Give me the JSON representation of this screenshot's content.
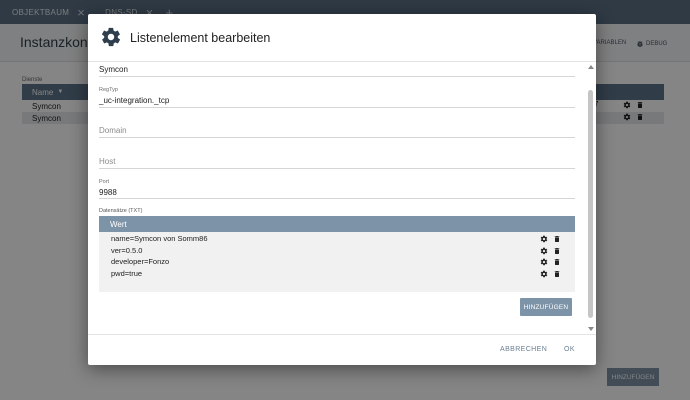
{
  "tabs": [
    {
      "label": "OBJEKTBAUM"
    },
    {
      "label": "DNS-SD"
    }
  ],
  "background": {
    "page_title": "Instanzkonfi",
    "toolbar_variables": "VARIABLEN",
    "toolbar_debug": "DEBUG",
    "list_label": "Dienste",
    "column_name": "Name",
    "rows": [
      {
        "name": "Symcon",
        "extra": "7"
      },
      {
        "name": "Symcon",
        "extra": ""
      }
    ],
    "add_button": "HINZUFÜGEN"
  },
  "dialog": {
    "title": "Listenelement bearbeiten",
    "fields": {
      "name_value": "Symcon",
      "regtype_label": "RegTyp",
      "regtype_value": "_uc-integration._tcp",
      "domain_placeholder": "Domain",
      "host_placeholder": "Host",
      "port_label": "Port",
      "port_value": "9988"
    },
    "txt_section_label": "Datensätze (TXT)",
    "txt_column": "Wert",
    "txt_rows": [
      {
        "value": "name=Symcon von Somm86"
      },
      {
        "value": "ver=0.5.0"
      },
      {
        "value": "developer=Fonzo"
      },
      {
        "value": "pwd=true"
      }
    ],
    "add_button": "HINZUFÜGEN",
    "cancel_button": "ABBRECHEN",
    "ok_button": "OK"
  },
  "colors": {
    "tabbar": "#5a6f84",
    "header_row": "#7c93a8",
    "button": "#7d93a8",
    "accent_text": "#6a7f93",
    "overlay": "rgba(0,0,0,0.48)"
  },
  "icons": {
    "dialog": "gear-icon",
    "row_edit": "gear-icon",
    "row_delete": "trash-icon"
  }
}
